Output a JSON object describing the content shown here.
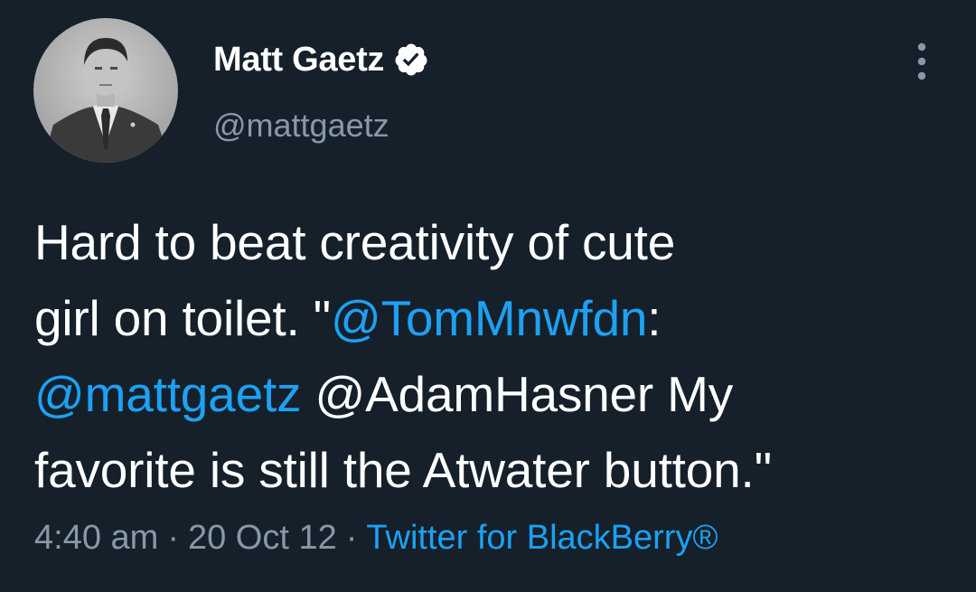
{
  "colors": {
    "background": "#15202b",
    "text": "#ffffff",
    "secondary": "#8899a6",
    "link": "#1da1f2"
  },
  "author": {
    "display_name": "Matt Gaetz",
    "handle": "@mattgaetz",
    "verified": true,
    "verified_icon": "verified-badge-icon",
    "avatar_icon": "profile-photo"
  },
  "menu": {
    "icon": "more-vertical-icon"
  },
  "tweet": {
    "line1": "Hard to beat creativity of cute",
    "line2_text": "girl on toilet. \"",
    "line2_mention": "@TomMnwfdn",
    "line2_tail": ":",
    "line3_mention": "@mattgaetz",
    "line3_tail": " @AdamHasner My",
    "line4": "favorite is still the Atwater button.\""
  },
  "meta": {
    "time": "4:40 am",
    "separator": "·",
    "date": "20 Oct 12",
    "source": "Twitter for BlackBerry®"
  }
}
